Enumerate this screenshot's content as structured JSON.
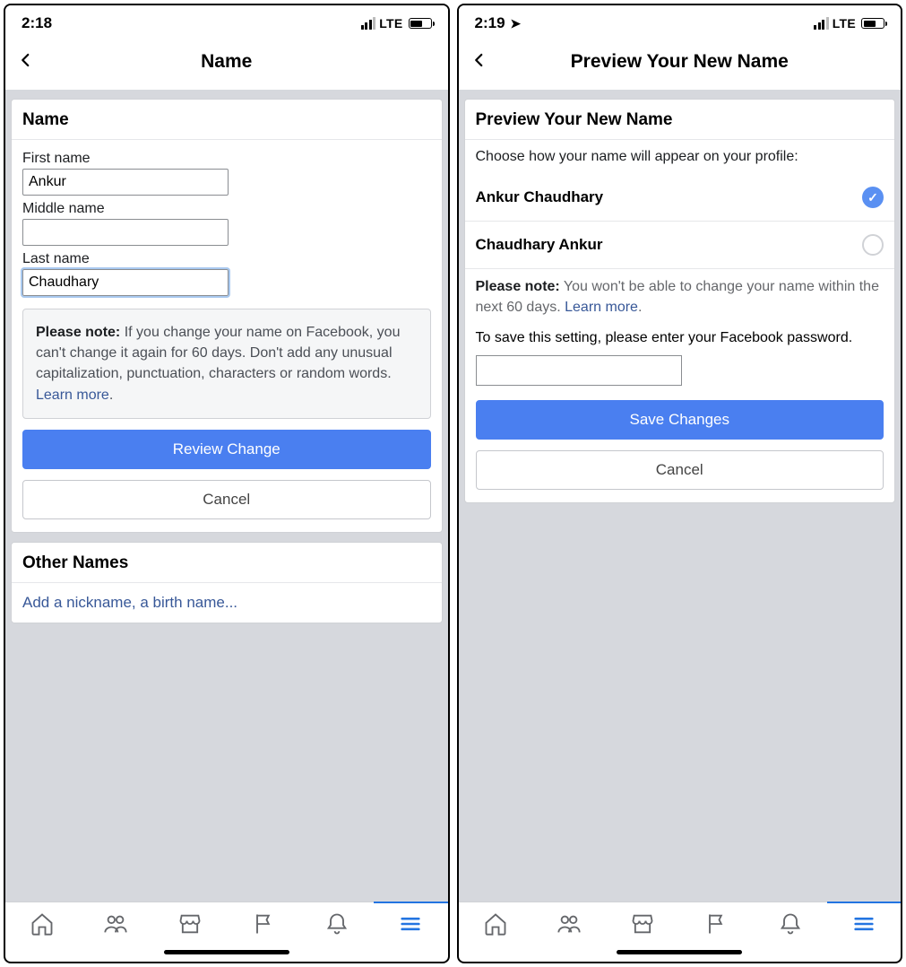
{
  "left": {
    "status": {
      "time": "2:18",
      "carrier": "LTE"
    },
    "header": {
      "title": "Name"
    },
    "name_card": {
      "heading": "Name",
      "first_label": "First name",
      "first_value": "Ankur",
      "middle_label": "Middle name",
      "middle_value": "",
      "last_label": "Last name",
      "last_value": "Chaudhary",
      "note_strong": "Please note:",
      "note_text": " If you change your name on Facebook, you can't change it again for 60 days. Don't add any unusual capitalization, punctuation, characters or random words. ",
      "learn_more": "Learn more",
      "review_btn": "Review Change",
      "cancel_btn": "Cancel"
    },
    "other_card": {
      "heading": "Other Names",
      "link": "Add a nickname, a birth name..."
    }
  },
  "right": {
    "status": {
      "time": "2:19",
      "carrier": "LTE"
    },
    "header": {
      "title": "Preview Your New Name"
    },
    "card": {
      "heading": "Preview Your New Name",
      "subtext": "Choose how your name will appear on your profile:",
      "option1": "Ankur Chaudhary",
      "option2": "Chaudhary Ankur",
      "note_strong": "Please note:",
      "note_text": " You won't be able to change your name within the next 60 days. ",
      "learn_more": "Learn more",
      "pwd_prompt": "To save this setting, please enter your Facebook password.",
      "save_btn": "Save Changes",
      "cancel_btn": "Cancel"
    }
  }
}
